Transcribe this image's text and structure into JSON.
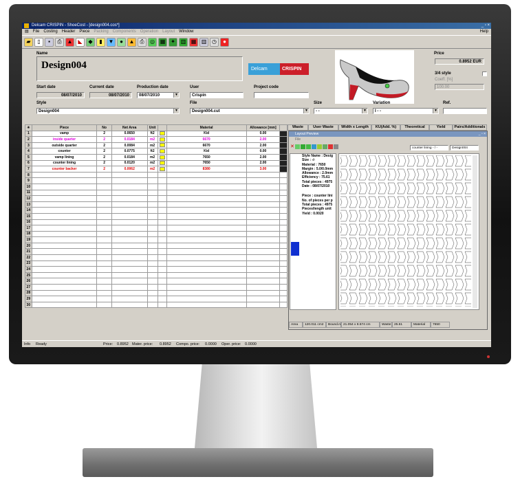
{
  "app": {
    "title": "Delcam CRISPIN - ShoeCost - [design004.cos*]",
    "menus": [
      "File",
      "Costing",
      "Header",
      "Piece",
      "Packing",
      "Components",
      "Operation",
      "Layout",
      "Window"
    ],
    "menus_disabled": [
      false,
      false,
      false,
      false,
      true,
      true,
      true,
      true,
      false
    ],
    "help_label": "Help"
  },
  "header": {
    "name_label": "Name",
    "name_value": "Design004",
    "price_label": "Price",
    "price_value": "0.8952 EUR",
    "style34_label": "3/4 style",
    "coeff_label": "Coeff. [%]",
    "coeff_value": "100.00",
    "start_date_label": "Start date",
    "start_date_value": "08/07/2010",
    "current_date_label": "Current date",
    "current_date_value": "08/07/2010",
    "production_date_label": "Production date",
    "production_date_value": "08/07/2010",
    "user_label": "User",
    "user_value": "Crispin",
    "project_code_label": "Project code",
    "project_code_value": "",
    "style_label": "Style",
    "style_value": "Design004",
    "file_label": "File",
    "file_value": "Design004.cut",
    "size_label": "Size",
    "size_value": "- -",
    "variation_label": "Variation",
    "variation_value": "I - -",
    "ref_label": "Ref.",
    "ref_value": ""
  },
  "logo": {
    "delcam": "Delcam",
    "crispin": "CRISPIN"
  },
  "grid": {
    "columns": [
      "Piece",
      "No",
      "Net Area",
      "Unit",
      "",
      "Material",
      "Allowance [mm]",
      ""
    ],
    "rows": [
      {
        "n": "1",
        "piece": "vamp",
        "no": "2",
        "area": "0.0650",
        "unit": "ft2",
        "material": "Kid",
        "allow": "0.00",
        "color": "#000000"
      },
      {
        "n": "2",
        "piece": "inside quarter",
        "no": "2",
        "area": "0.0184",
        "unit": "m2",
        "material": "6670",
        "allow": "2.00",
        "color": "#e000e0"
      },
      {
        "n": "3",
        "piece": "outside quarter",
        "no": "2",
        "area": "0.0084",
        "unit": "m2",
        "material": "6670",
        "allow": "2.00",
        "color": "#000000"
      },
      {
        "n": "4",
        "piece": "counter",
        "no": "2",
        "area": "0.0775",
        "unit": "ft2",
        "material": "Kid",
        "allow": "0.00",
        "color": "#000000"
      },
      {
        "n": "5",
        "piece": "vamp lining",
        "no": "2",
        "area": "0.0184",
        "unit": "m2",
        "material": "7650",
        "allow": "2.00",
        "color": "#000000"
      },
      {
        "n": "6",
        "piece": "counter lining",
        "no": "2",
        "area": "0.0120",
        "unit": "m2",
        "material": "7650",
        "allow": "2.00",
        "color": "#000000"
      },
      {
        "n": "7",
        "piece": "counter backer",
        "no": "2",
        "area": "0.0062",
        "unit": "m2",
        "material": "8380",
        "allow": "3.00",
        "color": "#e00000"
      }
    ],
    "empty_rows": [
      "8",
      "9",
      "10",
      "11",
      "12",
      "13",
      "14",
      "15",
      "16",
      "17",
      "18",
      "19",
      "20",
      "21",
      "22",
      "23",
      "24",
      "25",
      "26",
      "27",
      "28",
      "29",
      "30"
    ]
  },
  "side_columns": [
    "Waste",
    "User Waste",
    "Width x Length",
    "KU(Add. %)",
    "Theoretical",
    "Yield",
    "Pairs/Additionals"
  ],
  "popup": {
    "title": "Layout Preview",
    "file_menu": "File",
    "piece_field": "counter lining - / -",
    "style_field": "Design004",
    "info_lines": [
      "Style Name : Desig",
      "Size : -/-",
      "Material : 7650",
      "Margin : 5.0/0.0mm",
      "Allowance : 2.0mm",
      "Efficiency : 75.61",
      "Total pieces : 4975",
      "Date : 08/07/2010"
    ],
    "piece_lines": [
      "Piece : counter lini",
      "No. of pieces per p",
      "Total pieces : 4975",
      "Pieces/length unit",
      "Yield : 0.0020"
    ],
    "status": [
      "Area",
      "120.011 cm2",
      "Bound.rect",
      "21.054 x 8.574 cm",
      "Waste",
      "25.61",
      "Material",
      "7650"
    ]
  },
  "statusbar": {
    "info_label": "Info",
    "info_value": "Ready",
    "price_label": "Price:",
    "price_value": "0.8952",
    "mater_label": "Mater. price:",
    "mater_value": "0.8952",
    "compo_label": "Compo. price:",
    "compo_value": "0.0000",
    "oper_label": "Oper. price:",
    "oper_value": "0.0000"
  }
}
